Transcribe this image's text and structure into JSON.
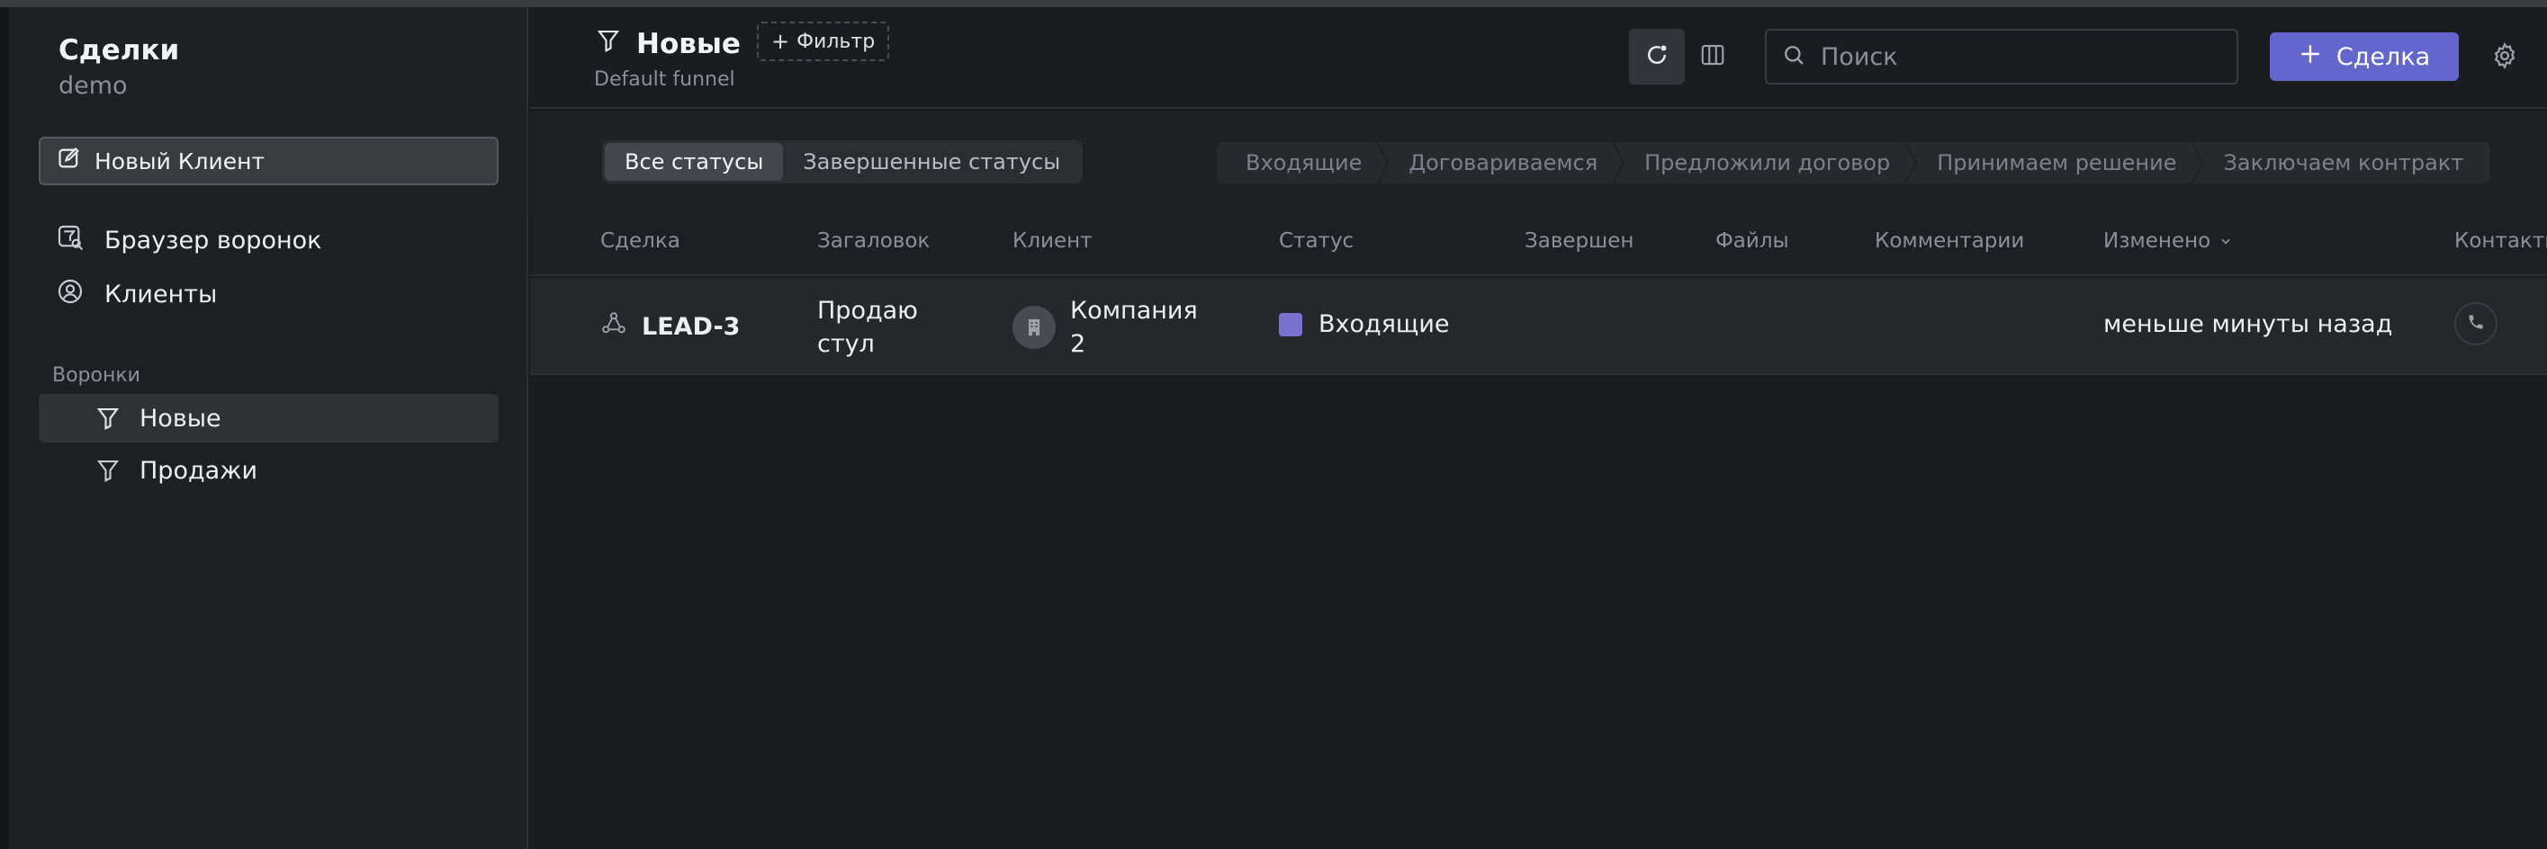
{
  "sidebar": {
    "title": "Сделки",
    "subtitle": "demo",
    "new_client_label": "Новый Клиент",
    "nav": [
      {
        "label": "Браузер воронок",
        "icon": "funnel-search-icon"
      },
      {
        "label": "Клиенты",
        "icon": "user-circle-icon"
      }
    ],
    "funnels_label": "Воронки",
    "funnels": [
      {
        "label": "Новые",
        "icon": "funnel-icon",
        "active": true
      },
      {
        "label": "Продажи",
        "icon": "funnel-icon",
        "active": false
      }
    ]
  },
  "header": {
    "title": "Новые",
    "subtitle": "Default funnel",
    "filter_label": "Фильтр",
    "search_placeholder": "Поиск",
    "add_label": "Сделка"
  },
  "status_tabs": [
    {
      "label": "Все статусы",
      "active": true
    },
    {
      "label": "Завершенные статусы",
      "active": false
    }
  ],
  "stages": [
    "Входящие",
    "Договариваемся",
    "Предложили договор",
    "Принимаем решение",
    "Заключаем контракт"
  ],
  "table": {
    "columns": [
      "Сделка",
      "Загаловок",
      "Клиент",
      "Статус",
      "Завершен",
      "Файлы",
      "Комментарии",
      "Изменено",
      "Контакты"
    ],
    "rows": [
      {
        "deal": "LEAD-3",
        "title": "Продаю стул",
        "client": "Компания 2",
        "status": "Входящие",
        "status_color": "#7b72cf",
        "changed": "меньше минуты назад"
      }
    ]
  },
  "colors": {
    "accent": "#6366cc",
    "background": "#1b1c1f",
    "sidebar": "#1e1f22"
  }
}
